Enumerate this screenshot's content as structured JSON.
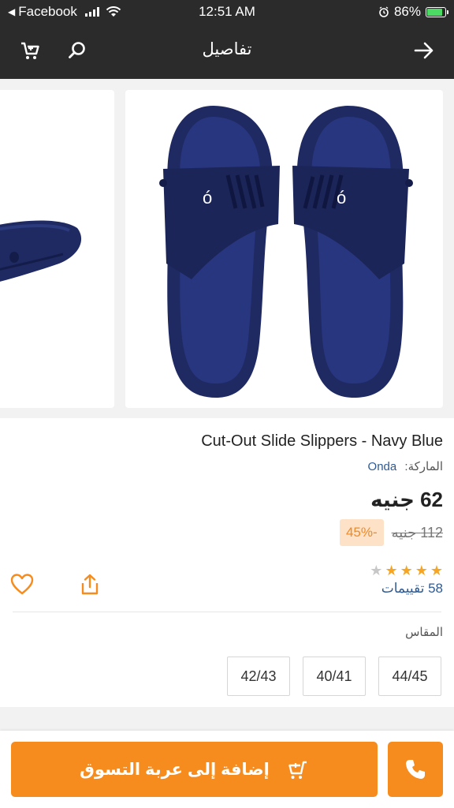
{
  "status_bar": {
    "back_app": "Facebook",
    "time": "12:51 AM",
    "battery_percent": "86%",
    "battery_level": 0.86
  },
  "app_bar": {
    "title": "تفاصيل",
    "cart_icon": "cart-icon",
    "search_icon": "search-icon",
    "back_icon": "arrow-right-icon"
  },
  "product": {
    "title": "Cut-Out Slide Slippers - Navy Blue",
    "brand_label": "الماركة:",
    "brand_name": "Onda",
    "price": "62 جنيه",
    "old_price": "112 جنيه",
    "discount": "-45%",
    "rating": 4,
    "rating_max": 5,
    "ratings_count": "58 تقييمات",
    "size_label": "المقاس",
    "sizes": [
      "44/45",
      "40/41",
      "42/43"
    ]
  },
  "actions": {
    "add_to_cart": "إضافة إلى عربة التسوق",
    "wishlist_icon": "heart-icon",
    "share_icon": "share-icon",
    "call_icon": "phone-icon"
  },
  "colors": {
    "accent": "#f68b1e",
    "header": "#2b2b2b",
    "link": "#2f5a93",
    "product": "#1f2a63"
  }
}
